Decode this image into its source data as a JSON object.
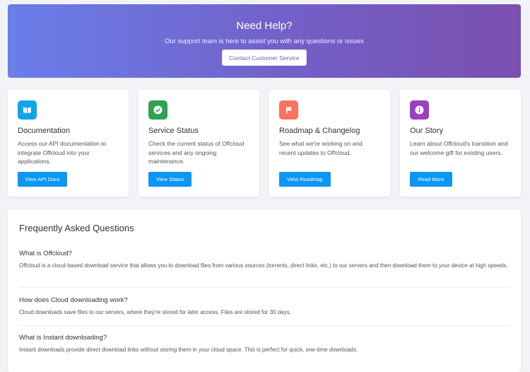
{
  "hero": {
    "title": "Need Help?",
    "subtitle": "Our support team is here to assist you with any questions or issues",
    "button": "Contact Customer Service"
  },
  "cards": [
    {
      "icon": "book-icon",
      "icon_color": "#0ea5e9",
      "title": "Documentation",
      "desc": "Access our API documentation to integrate Offcloud into your applications.",
      "button": "View API Docs"
    },
    {
      "icon": "check-icon",
      "icon_color": "#2fa24f",
      "title": "Service Status",
      "desc": "Check the current status of Offcloud services and any ongoing maintenance.",
      "button": "View Status"
    },
    {
      "icon": "flag-icon",
      "icon_color": "#f97360",
      "title": "Roadmap & Changelog",
      "desc": "See what we're working on and recent updates to Offcloud.",
      "button": "View Roadmap"
    },
    {
      "icon": "info-icon",
      "icon_color": "#9b3fc0",
      "title": "Our Story",
      "desc": "Learn about Offcloud's transition and our welcome gift for existing users.",
      "button": "Read More"
    }
  ],
  "faq": {
    "title": "Frequently Asked Questions",
    "items": [
      {
        "q": "What is Offcloud?",
        "a": "Offcloud is a cloud-based download service that allows you to download files from various sources (torrents, direct links, etc.) to our servers and then download them to your device at high speeds."
      },
      {
        "q": "How does Cloud downloading work?",
        "a": "Cloud downloads save files to our servers, where they're stored for later access. Files are stored for 30 days."
      },
      {
        "q": "What is Instant downloading?",
        "a": "Instant downloads provide direct download links without storing them in your cloud space. This is perfect for quick, one-time downloads."
      }
    ]
  },
  "colors": {
    "accent_button": "#0d96f2",
    "hero_start": "#6a7ee9",
    "hero_end": "#7b4fae"
  }
}
